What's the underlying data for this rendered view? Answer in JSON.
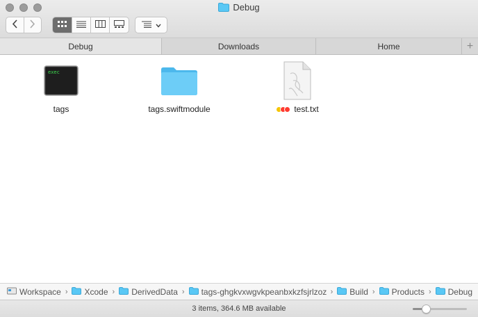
{
  "window": {
    "title": "Debug"
  },
  "toolbar": {
    "back_icon": "chevron-left-icon",
    "forward_icon": "chevron-right-icon",
    "view_modes": [
      "icon-view-icon",
      "list-view-icon",
      "column-view-icon",
      "gallery-view-icon"
    ],
    "active_view": "icon-view-icon",
    "group_icon": "group-by-icon"
  },
  "tabs": [
    {
      "label": "Debug",
      "active": true
    },
    {
      "label": "Downloads",
      "active": false
    },
    {
      "label": "Home",
      "active": false
    }
  ],
  "items": [
    {
      "name": "tags",
      "icon": "exec-icon",
      "icon_text": "exec"
    },
    {
      "name": "tags.swiftmodule",
      "icon": "folder-icon"
    },
    {
      "name": "test.txt",
      "icon": "text-document-icon",
      "tags": [
        "#f5c400",
        "#ff3b30",
        "#ff3b30"
      ]
    }
  ],
  "pathbar": [
    {
      "label": "Workspace",
      "icon": "drive-icon"
    },
    {
      "label": "Xcode",
      "icon": "folder-icon"
    },
    {
      "label": "DerivedData",
      "icon": "folder-icon"
    },
    {
      "label": "tags-ghgkvxwgvkpeanbxkzfsjrlzoz",
      "icon": "folder-icon"
    },
    {
      "label": "Build",
      "icon": "folder-icon"
    },
    {
      "label": "Products",
      "icon": "folder-icon"
    },
    {
      "label": "Debug",
      "icon": "folder-icon"
    }
  ],
  "status": {
    "text": "3 items, 364.6 MB available",
    "zoom_level": 0.2
  },
  "colors": {
    "folder": "#5ac8f5",
    "active_view": "#6d6d6d"
  }
}
